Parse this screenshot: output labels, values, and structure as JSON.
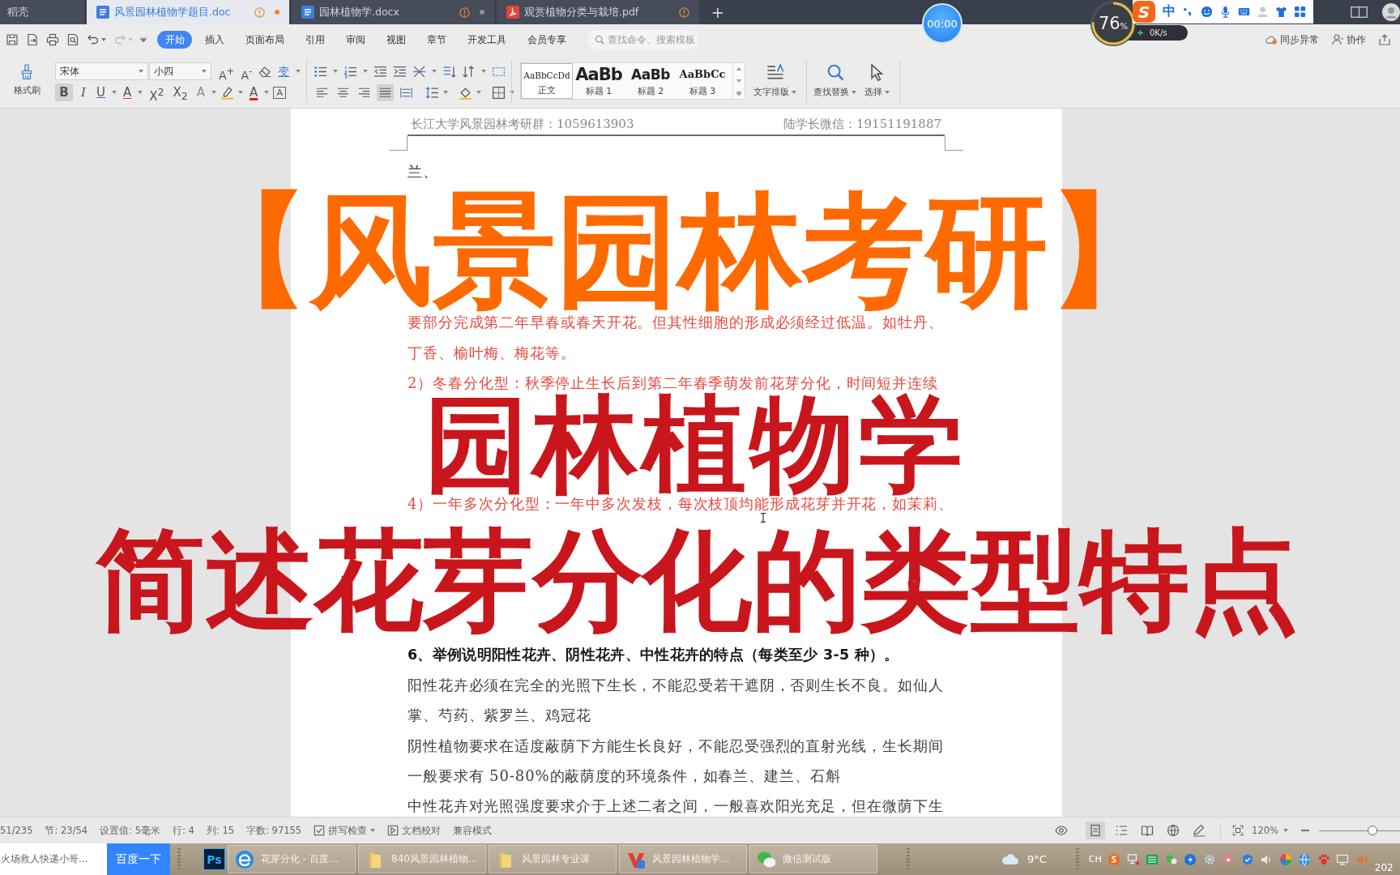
{
  "title_bar": {
    "tabs": [
      {
        "kind": "home",
        "label": "稻壳",
        "selected": false
      },
      {
        "kind": "doc",
        "label": "风景园林植物学题目.doc",
        "selected": true
      },
      {
        "kind": "doc",
        "label": "园林植物学.docx",
        "selected": false
      },
      {
        "kind": "pdf",
        "label": "观赏植物分类与栽培.pdf",
        "selected": false
      }
    ],
    "new_tab": "+"
  },
  "recorder": {
    "time": "00:00"
  },
  "speed_meter": {
    "value": "76",
    "unit": "%",
    "level": 0.76,
    "speed": "0K/s"
  },
  "ime_toolbar": {
    "logo": "S",
    "mode": "中"
  },
  "menu": {
    "quick_access": [
      {
        "kind": "save",
        "disabled": false
      },
      {
        "kind": "export",
        "disabled": false
      },
      {
        "kind": "print",
        "disabled": false
      },
      {
        "kind": "preview",
        "disabled": false
      },
      {
        "kind": "undo",
        "disabled": false
      },
      {
        "kind": "redo",
        "disabled": true
      }
    ],
    "tabs": [
      {
        "label": "开始",
        "selected": true
      },
      {
        "label": "插入",
        "selected": false
      },
      {
        "label": "页面布局",
        "selected": false
      },
      {
        "label": "引用",
        "selected": false
      },
      {
        "label": "审阅",
        "selected": false
      },
      {
        "label": "视图",
        "selected": false
      },
      {
        "label": "章节",
        "selected": false
      },
      {
        "label": "开发工具",
        "selected": false
      },
      {
        "label": "会员专享",
        "selected": false
      }
    ],
    "search": {
      "placeholder": "查找命令、搜索模板"
    },
    "sync": "同步异常",
    "collaborate": "协作"
  },
  "ribbon": {
    "format_painter": "格式刷",
    "font": {
      "value": "宋体"
    },
    "size": {
      "value": "小四"
    },
    "font_tools": [
      {
        "kind": "grow",
        "label": "A$^{+}$"
      },
      {
        "kind": "shrink",
        "label": "A$^{-}$"
      },
      {
        "kind": "clear"
      },
      {
        "kind": "pinyin",
        "label": "变"
      }
    ],
    "font_buttons": [
      {
        "kind": "bold",
        "label": "B",
        "selected": true
      },
      {
        "kind": "italic",
        "label": "I",
        "selected": false
      },
      {
        "kind": "underline",
        "label": "U",
        "selected": false
      },
      {
        "kind": "strike",
        "label": "A",
        "selected": false
      },
      {
        "kind": "superscript",
        "label": "X$^{2}$",
        "selected": false
      },
      {
        "kind": "subscript",
        "label": "X$_{2}$",
        "selected": false
      },
      {
        "kind": "effect",
        "label": "A",
        "selected": false
      },
      {
        "kind": "highlight",
        "selected": false
      },
      {
        "kind": "color",
        "label": "A",
        "selected": false
      },
      {
        "kind": "border",
        "label": "A",
        "selected": false
      }
    ],
    "alignment": [
      {
        "kind": "left",
        "selected": false
      },
      {
        "kind": "center",
        "selected": false
      },
      {
        "kind": "right",
        "selected": false
      },
      {
        "kind": "justify",
        "selected": true
      },
      {
        "kind": "distribute",
        "selected": false
      }
    ],
    "styles": [
      {
        "sample": "AaBbCcDd",
        "label": "正文",
        "selected": true
      },
      {
        "sample": "AaBb",
        "label": "标题 1",
        "selected": false
      },
      {
        "sample": "AaBb",
        "label": "标题 2",
        "selected": false
      },
      {
        "sample": "AaBbCc",
        "label": "标题 3",
        "selected": false
      }
    ],
    "tools": [
      {
        "kind": "layout",
        "label": "文字排版"
      },
      {
        "kind": "find",
        "label": "查找替换"
      },
      {
        "kind": "select",
        "label": "选择"
      }
    ]
  },
  "document": {
    "header_left": "长江大学风景园林考研群：1059613903",
    "header_right": "陆学长微信：19151191887",
    "lines": [
      {
        "kind": "body",
        "text": "兰、"
      },
      {
        "kind": "covered"
      },
      {
        "kind": "covered"
      },
      {
        "kind": "covered"
      },
      {
        "kind": "covered"
      },
      {
        "kind": "answer",
        "text": "要部分完成第二年早春或春天开花。但其性细胞的形成必须经过低温。如牡丹、"
      },
      {
        "kind": "answer",
        "text": "丁香、榆叶梅、梅花等。"
      },
      {
        "kind": "answer",
        "text": "2）冬春分化型：秋季停止生长后到第二年春季萌发前花芽分化，时间短并连续"
      },
      {
        "kind": "covered"
      },
      {
        "kind": "covered"
      },
      {
        "kind": "covered"
      },
      {
        "kind": "answer",
        "text": "4）一年多次分化型：一年中多次发枝，每次枝顶均能形成花芽并开花，如茉莉、"
      },
      {
        "kind": "covered"
      },
      {
        "kind": "covered"
      },
      {
        "kind": "covered"
      },
      {
        "kind": "covered"
      },
      {
        "kind": "heading",
        "text": "6、举例说明阳性花卉、阴性花卉、中性花卉的特点（每类至少 3-5 种）。"
      },
      {
        "kind": "body",
        "text": "阳性花卉必须在完全的光照下生长，不能忍受若干遮阴，否则生长不良。如仙人"
      },
      {
        "kind": "body",
        "text": "掌、芍药、紫罗兰、鸡冠花"
      },
      {
        "kind": "body",
        "text": "阴性植物要求在适度蔽荫下方能生长良好，不能忍受强烈的直射光线，生长期间"
      },
      {
        "kind": "body",
        "text": "一般要求有 50-80%的蔽荫度的环境条件，如春兰、建兰、石斛"
      },
      {
        "kind": "body",
        "text": "中性花卉对光照强度要求介于上述二者之间，一般喜欢阳光充足，但在微荫下生"
      }
    ]
  },
  "overlay_titles": [
    {
      "text": "【风景园林考研】",
      "color": "#ff6a00"
    },
    {
      "text": "园林植物学",
      "color": "#c9161d"
    },
    {
      "text": "简述花芽分化的类型特点",
      "color": "#c9161d"
    }
  ],
  "status_bar": {
    "items": [
      {
        "kind": "text",
        "label": "51/235"
      },
      {
        "kind": "text",
        "label": "节: 23/54"
      },
      {
        "kind": "text",
        "label": "设置值: 5毫米"
      },
      {
        "kind": "text",
        "label": "行: 4"
      },
      {
        "kind": "text",
        "label": "列: 15"
      },
      {
        "kind": "text",
        "label": "字数: 97155"
      },
      {
        "kind": "spellcheck",
        "label": "拼写检查"
      },
      {
        "kind": "proofread",
        "label": "文档校对"
      },
      {
        "kind": "text",
        "label": "兼容模式"
      }
    ],
    "view_modes": [
      {
        "kind": "page",
        "selected": true
      },
      {
        "kind": "outline",
        "selected": false
      },
      {
        "kind": "reading",
        "selected": false
      },
      {
        "kind": "web",
        "selected": false
      },
      {
        "kind": "write",
        "selected": false
      }
    ],
    "zoom": "120%",
    "zoom_slider": {
      "level": 0.66
    }
  },
  "taskbar": {
    "search": {
      "value": "火场救人快递小哥..."
    },
    "search_button": "百度一下",
    "pinned": [
      {
        "label": "Ps"
      }
    ],
    "tasks": [
      {
        "kind": "browser",
        "label": "花芽分化 - 百度..."
      },
      {
        "kind": "folder",
        "label": "840风景园林植物..."
      },
      {
        "kind": "folder",
        "label": "风景园林专业课"
      },
      {
        "kind": "wps",
        "label": "风景园林植物学..."
      },
      {
        "kind": "wechat",
        "label": "微信测试版"
      }
    ],
    "weather": "9°C",
    "language": "CH",
    "clock": "202"
  }
}
